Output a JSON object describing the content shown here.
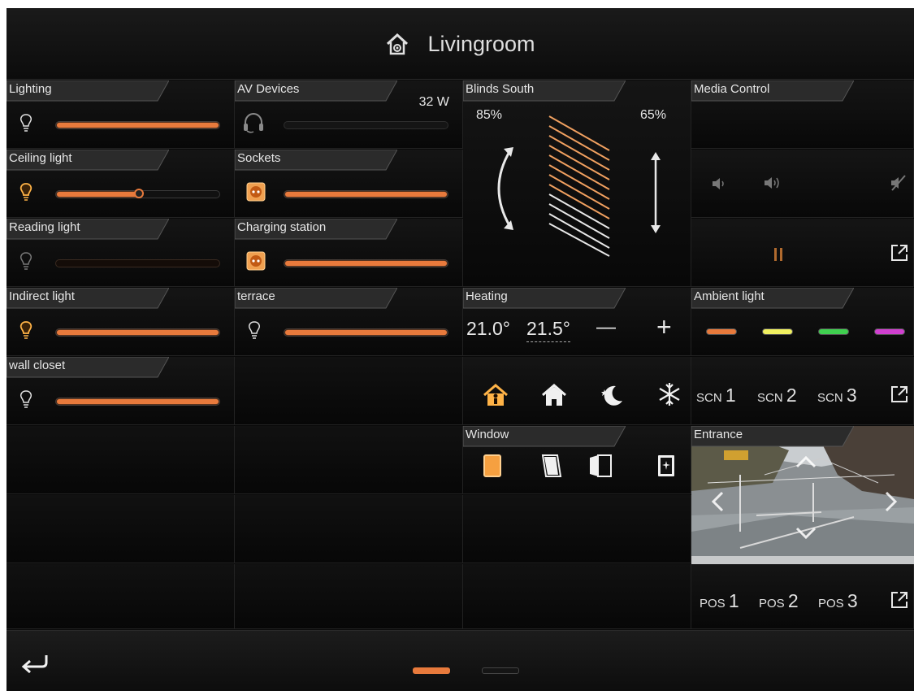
{
  "header": {
    "title": "Livingroom",
    "icon": "home-settings-icon"
  },
  "tiles": {
    "lighting": {
      "label": "Lighting",
      "icon": "bulb-icon",
      "level": 1.0
    },
    "av": {
      "label": "AV Devices",
      "power": "32 W",
      "icon": "headphones-icon",
      "level": 0.0
    },
    "ceiling": {
      "label": "Ceiling light",
      "icon": "bulb-on-icon",
      "level": 0.5
    },
    "sockets": {
      "label": "Sockets",
      "icon": "socket-icon",
      "level": 1.0
    },
    "reading": {
      "label": "Reading light",
      "icon": "bulb-off-icon",
      "level": 0.0
    },
    "charging": {
      "label": "Charging station",
      "icon": "socket-icon",
      "level": 1.0
    },
    "indirect": {
      "label": "Indirect light",
      "icon": "bulb-on-icon",
      "level": 1.0
    },
    "terrace": {
      "label": "terrace",
      "icon": "bulb-icon",
      "level": 1.0
    },
    "closet": {
      "label": "wall closet",
      "icon": "bulb-icon",
      "level": 1.0
    }
  },
  "blinds": {
    "label": "Blinds South",
    "left_value": "85%",
    "right_value": "65%"
  },
  "media": {
    "label": "Media Control",
    "icons": [
      "volume-down-icon",
      "volume-up-icon",
      "mute-icon",
      "pause-icon",
      "open-external-icon"
    ]
  },
  "heating": {
    "label": "Heating",
    "current": "21.0°",
    "setpoint": "21.5°",
    "minus": "—",
    "plus": "+",
    "modes": [
      "comfort-mode-icon",
      "standby-mode-icon",
      "night-mode-icon",
      "frost-protection-icon"
    ]
  },
  "ambient": {
    "label": "Ambient light",
    "colors": [
      "#e87a3c",
      "#f0f060",
      "#40d050",
      "#d040d0"
    ],
    "scenes": [
      {
        "prefix": "SCN",
        "num": "1"
      },
      {
        "prefix": "SCN",
        "num": "2"
      },
      {
        "prefix": "SCN",
        "num": "3"
      }
    ]
  },
  "window": {
    "label": "Window",
    "icons": [
      "window-closed-icon",
      "window-tilted-icon",
      "window-open-icon",
      "window-alarm-icon"
    ]
  },
  "entrance": {
    "label": "Entrance",
    "positions": [
      {
        "prefix": "POS",
        "num": "1"
      },
      {
        "prefix": "POS",
        "num": "2"
      },
      {
        "prefix": "POS",
        "num": "3"
      }
    ]
  },
  "colors": {
    "accent": "#e87a3c",
    "background": "#0a0a0a",
    "text": "#e6e6e6"
  },
  "footer": {
    "back_icon": "back-arrow-icon",
    "pages": [
      {
        "active": true
      },
      {
        "active": false
      }
    ]
  }
}
